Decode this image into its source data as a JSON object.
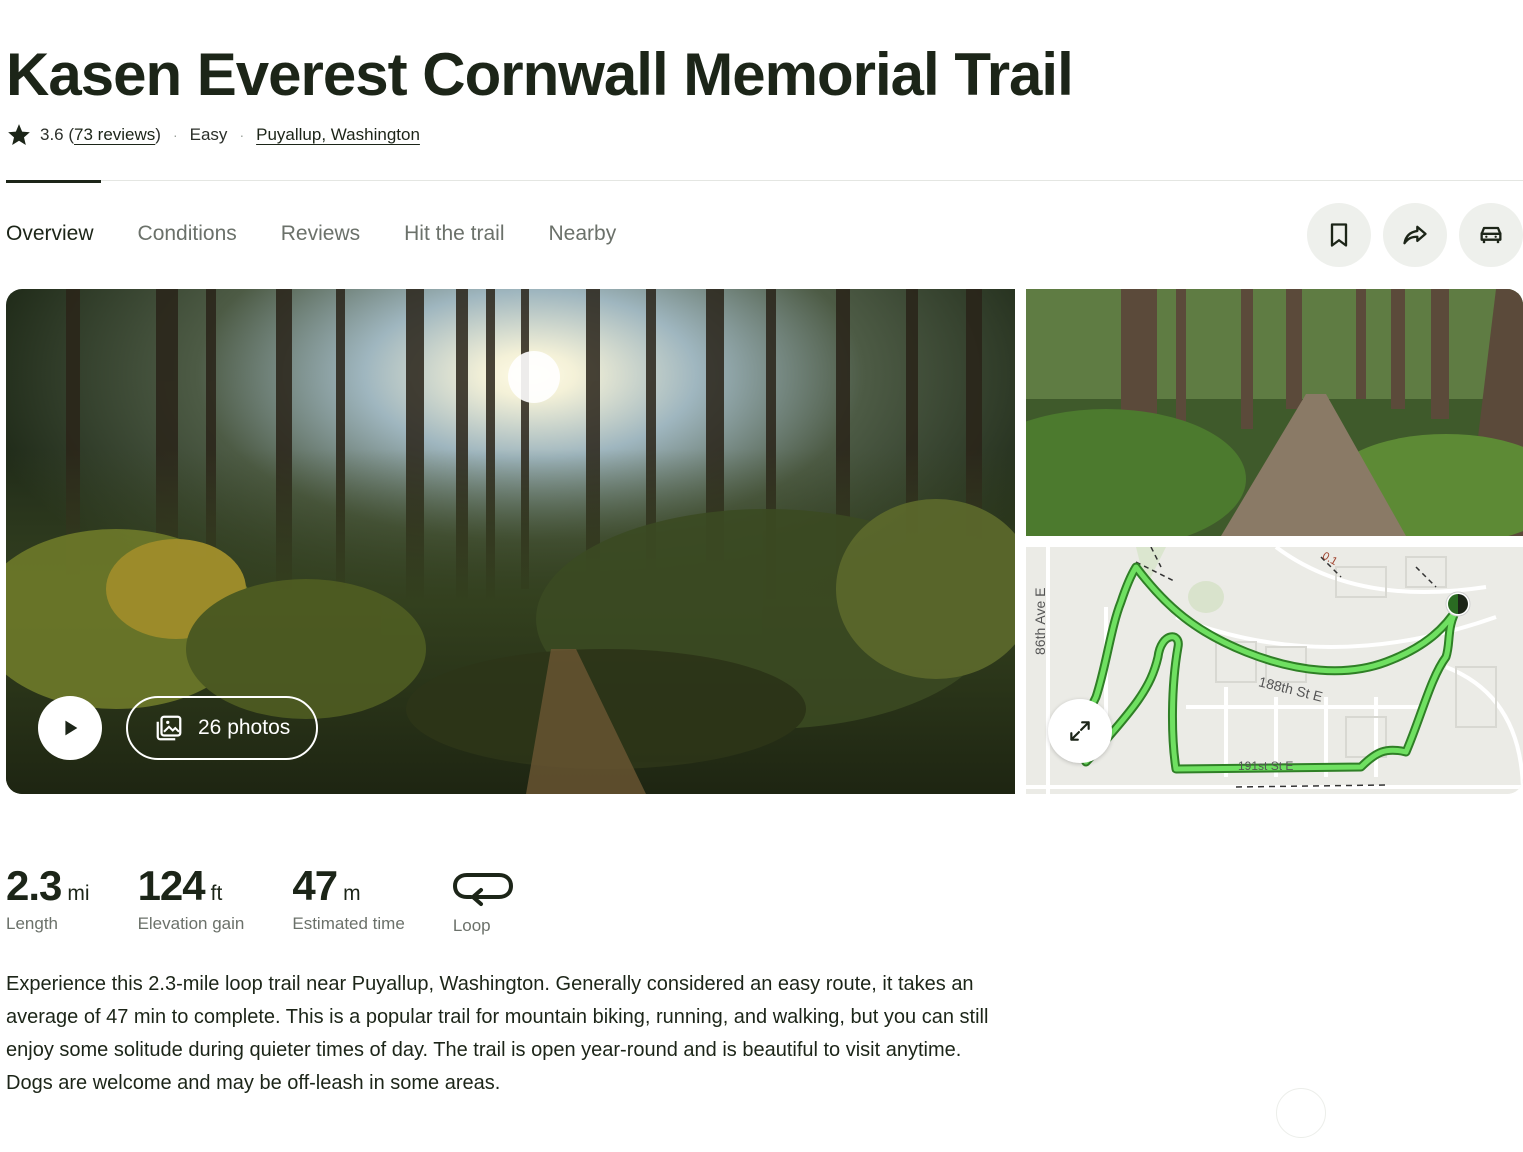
{
  "trail": {
    "title": "Kasen Everest Cornwall Memorial Trail",
    "rating": "3.6 (",
    "reviews_link": "73 reviews",
    "rating_close": ")",
    "difficulty": "Easy",
    "location": "Puyallup, Washington"
  },
  "tabs": [
    {
      "label": "Overview",
      "active": true
    },
    {
      "label": "Conditions",
      "active": false
    },
    {
      "label": "Reviews",
      "active": false
    },
    {
      "label": "Hit the trail",
      "active": false
    },
    {
      "label": "Nearby",
      "active": false
    }
  ],
  "actions": {
    "icons": [
      "bookmark-icon",
      "share-icon",
      "car-icon"
    ]
  },
  "media": {
    "photos_label": "26 photos",
    "map": {
      "street_1": "86th Ave E",
      "street_2": "188th St E",
      "street_3": "191st St E",
      "marker": "0.1"
    }
  },
  "stats": {
    "length_value": "2.3",
    "length_unit": "mi",
    "length_label": "Length",
    "elevation_value": "124",
    "elevation_unit": "ft",
    "elevation_label": "Elevation gain",
    "time_value": "47",
    "time_unit": "m",
    "time_label": "Estimated time",
    "route_label": "Loop"
  },
  "description": "Experience this 2.3-mile loop trail near Puyallup, Washington. Generally considered an easy route, it takes an average of 47 min to complete. This is a popular trail for mountain biking, running, and walking, but you can still enjoy some solitude during quieter times of day. The trail is open year-round and is beautiful to visit anytime. Dogs are welcome and may be off-leash in some areas.",
  "colors": {
    "trail_line": "#48c23b",
    "text_dark": "#1c2518",
    "text_muted": "#6b716a"
  }
}
